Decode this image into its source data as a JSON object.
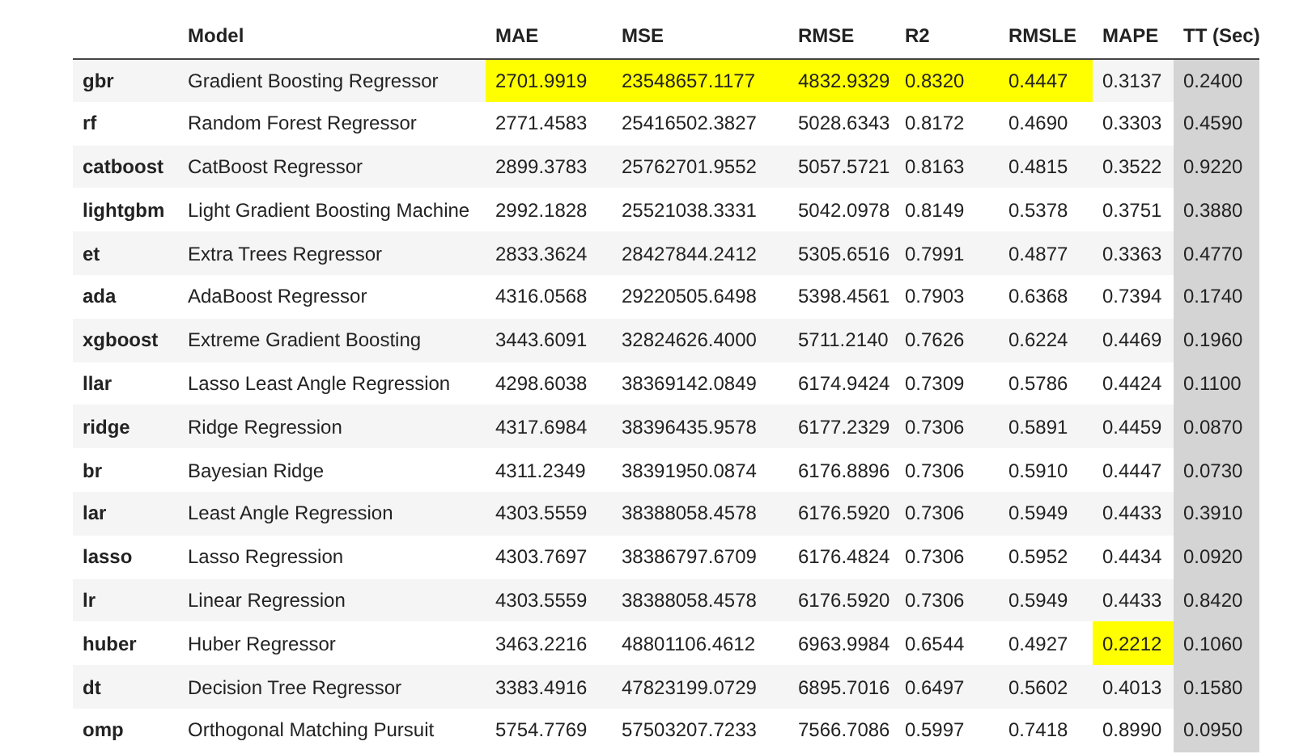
{
  "table": {
    "columns": [
      "",
      "Model",
      "MAE",
      "MSE",
      "RMSE",
      "R2",
      "RMSLE",
      "MAPE",
      "TT (Sec)"
    ],
    "rows": [
      {
        "id": "gbr",
        "model": "Gradient Boosting Regressor",
        "metrics": [
          "2701.9919",
          "23548657.1177",
          "4832.9329",
          "0.8320",
          "0.4447",
          "0.3137",
          "0.2400"
        ],
        "highlighted": [
          true,
          true,
          true,
          true,
          true,
          false,
          false
        ]
      },
      {
        "id": "rf",
        "model": "Random Forest Regressor",
        "metrics": [
          "2771.4583",
          "25416502.3827",
          "5028.6343",
          "0.8172",
          "0.4690",
          "0.3303",
          "0.4590"
        ],
        "highlighted": [
          false,
          false,
          false,
          false,
          false,
          false,
          false
        ]
      },
      {
        "id": "catboost",
        "model": "CatBoost Regressor",
        "metrics": [
          "2899.3783",
          "25762701.9552",
          "5057.5721",
          "0.8163",
          "0.4815",
          "0.3522",
          "0.9220"
        ],
        "highlighted": [
          false,
          false,
          false,
          false,
          false,
          false,
          false
        ]
      },
      {
        "id": "lightgbm",
        "model": "Light Gradient Boosting Machine",
        "metrics": [
          "2992.1828",
          "25521038.3331",
          "5042.0978",
          "0.8149",
          "0.5378",
          "0.3751",
          "0.3880"
        ],
        "highlighted": [
          false,
          false,
          false,
          false,
          false,
          false,
          false
        ]
      },
      {
        "id": "et",
        "model": "Extra Trees Regressor",
        "metrics": [
          "2833.3624",
          "28427844.2412",
          "5305.6516",
          "0.7991",
          "0.4877",
          "0.3363",
          "0.4770"
        ],
        "highlighted": [
          false,
          false,
          false,
          false,
          false,
          false,
          false
        ]
      },
      {
        "id": "ada",
        "model": "AdaBoost Regressor",
        "metrics": [
          "4316.0568",
          "29220505.6498",
          "5398.4561",
          "0.7903",
          "0.6368",
          "0.7394",
          "0.1740"
        ],
        "highlighted": [
          false,
          false,
          false,
          false,
          false,
          false,
          false
        ]
      },
      {
        "id": "xgboost",
        "model": "Extreme Gradient Boosting",
        "metrics": [
          "3443.6091",
          "32824626.4000",
          "5711.2140",
          "0.7626",
          "0.6224",
          "0.4469",
          "0.1960"
        ],
        "highlighted": [
          false,
          false,
          false,
          false,
          false,
          false,
          false
        ]
      },
      {
        "id": "llar",
        "model": "Lasso Least Angle Regression",
        "metrics": [
          "4298.6038",
          "38369142.0849",
          "6174.9424",
          "0.7309",
          "0.5786",
          "0.4424",
          "0.1100"
        ],
        "highlighted": [
          false,
          false,
          false,
          false,
          false,
          false,
          false
        ]
      },
      {
        "id": "ridge",
        "model": "Ridge Regression",
        "metrics": [
          "4317.6984",
          "38396435.9578",
          "6177.2329",
          "0.7306",
          "0.5891",
          "0.4459",
          "0.0870"
        ],
        "highlighted": [
          false,
          false,
          false,
          false,
          false,
          false,
          false
        ]
      },
      {
        "id": "br",
        "model": "Bayesian Ridge",
        "metrics": [
          "4311.2349",
          "38391950.0874",
          "6176.8896",
          "0.7306",
          "0.5910",
          "0.4447",
          "0.0730"
        ],
        "highlighted": [
          false,
          false,
          false,
          false,
          false,
          false,
          false
        ]
      },
      {
        "id": "lar",
        "model": "Least Angle Regression",
        "metrics": [
          "4303.5559",
          "38388058.4578",
          "6176.5920",
          "0.7306",
          "0.5949",
          "0.4433",
          "0.3910"
        ],
        "highlighted": [
          false,
          false,
          false,
          false,
          false,
          false,
          false
        ]
      },
      {
        "id": "lasso",
        "model": "Lasso Regression",
        "metrics": [
          "4303.7697",
          "38386797.6709",
          "6176.4824",
          "0.7306",
          "0.5952",
          "0.4434",
          "0.0920"
        ],
        "highlighted": [
          false,
          false,
          false,
          false,
          false,
          false,
          false
        ]
      },
      {
        "id": "lr",
        "model": "Linear Regression",
        "metrics": [
          "4303.5559",
          "38388058.4578",
          "6176.5920",
          "0.7306",
          "0.5949",
          "0.4433",
          "0.8420"
        ],
        "highlighted": [
          false,
          false,
          false,
          false,
          false,
          false,
          false
        ]
      },
      {
        "id": "huber",
        "model": "Huber Regressor",
        "metrics": [
          "3463.2216",
          "48801106.4612",
          "6963.9984",
          "0.6544",
          "0.4927",
          "0.2212",
          "0.1060"
        ],
        "highlighted": [
          false,
          false,
          false,
          false,
          false,
          true,
          false
        ]
      },
      {
        "id": "dt",
        "model": "Decision Tree Regressor",
        "metrics": [
          "3383.4916",
          "47823199.0729",
          "6895.7016",
          "0.6497",
          "0.5602",
          "0.4013",
          "0.1580"
        ],
        "highlighted": [
          false,
          false,
          false,
          false,
          false,
          false,
          false
        ]
      },
      {
        "id": "omp",
        "model": "Orthogonal Matching Pursuit",
        "metrics": [
          "5754.7769",
          "57503207.7233",
          "7566.7086",
          "0.5997",
          "0.7418",
          "0.8990",
          "0.0950"
        ],
        "highlighted": [
          false,
          false,
          false,
          false,
          false,
          false,
          false
        ]
      }
    ]
  }
}
